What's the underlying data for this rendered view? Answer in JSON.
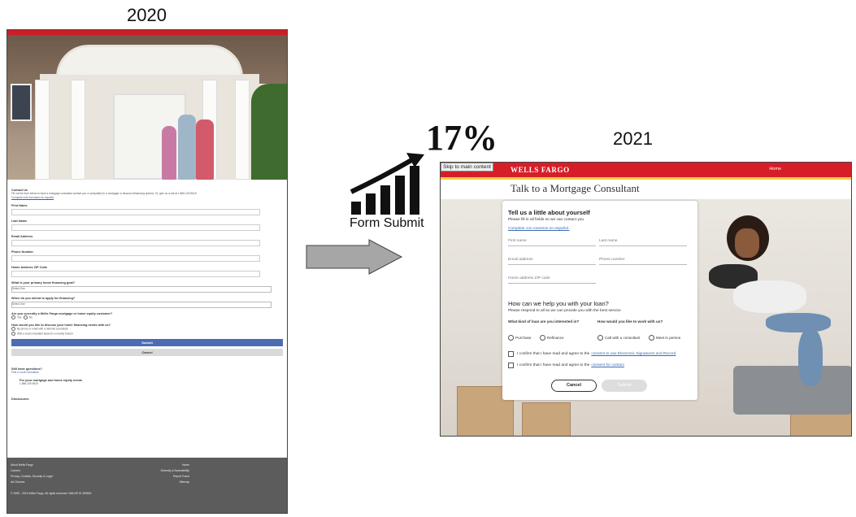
{
  "before": {
    "year": "2020",
    "form": {
      "heading": "Contact Us",
      "intro": "Fill out the form below to have a mortgage consultant contact you or prequalify for a mortgage or discuss refinancing options. Or, give us a call at 1-866-109-9615.",
      "spanish_link": "Complete este formulario en español",
      "fields": [
        "First Name",
        "Last Name",
        "Email Address",
        "Phone Number",
        "Home Address ZIP Code"
      ],
      "goal_label": "What is your primary home financing goal?",
      "goal_select": "Select One",
      "timing_label": "When do you intend to apply for financing?",
      "timing_select": "Select One",
      "customer_label": "Are you currently a Wells Fargo mortgage or home equity customer?",
      "yes": "Yes",
      "no": "No",
      "discuss_label": "How would you like to discuss your home financing needs with us?",
      "discuss_opt1": "By phone or email with a national consultant",
      "discuss_opt2": "With a local consultant based in a nearby branch",
      "submit": "Submit",
      "cancel": "Cancel",
      "questions_heading": "Still have questions?",
      "find_link": "Find a Local Consultant",
      "call_title": "For your mortgage and home equity needs",
      "call_phone": "1-866-109-9615",
      "disclosures": "Disclosures",
      "footer_left": [
        "About Wells Fargo",
        "Careers",
        "Privacy, Cookies, Security & Legal",
        "Ad Choices"
      ],
      "footer_right": [
        "Home",
        "Diversity & Accessibility",
        "Report Fraud",
        "Sitemap"
      ],
      "copyright": "© 1999 - 2019 Wells Fargo. All rights reserved. NMLSR ID 399801"
    }
  },
  "transition": {
    "percent": "17%",
    "label": "Form Submit"
  },
  "after": {
    "year": "2021",
    "skip_link": "Skip to main content",
    "brand": "WELLS FARGO",
    "nav_home": "Home",
    "page_title": "Talk to a Mortgage Consultant",
    "card": {
      "heading": "Tell us a little about yourself",
      "subheading": "Please fill in all fields so we can contact you",
      "spanish_link": "Complete con nosotros en español.",
      "placeholders": {
        "first_name": "First name",
        "last_name": "Last name",
        "email": "Email address",
        "phone": "Phone number",
        "zip": "Home address ZIP code"
      },
      "help_heading": "How can we help you with your loan?",
      "help_sub": "Please respond to all so we can provide you with the best service",
      "loan_q": "What kind of loan are you interested in?",
      "loan_opt1": "Purchase",
      "loan_opt2": "Refinance",
      "work_q": "How would you like to work with us?",
      "work_opt1": "Call with a consultant",
      "work_opt2": "Meet in person",
      "consent1_text": "I confirm that I have read and agree to the",
      "consent1_link": "consent to use Electronic Signatures and Record",
      "consent2_text": "I confirm that I have read and agree to the",
      "consent2_link": "consent for contact",
      "cancel": "Cancel",
      "submit": "Submit"
    }
  },
  "colors": {
    "brand_red": "#d71e28",
    "brand_yellow": "#ffcd41",
    "old_button_blue": "#4c6bb3",
    "arrow_gray": "#a6a6a6"
  }
}
